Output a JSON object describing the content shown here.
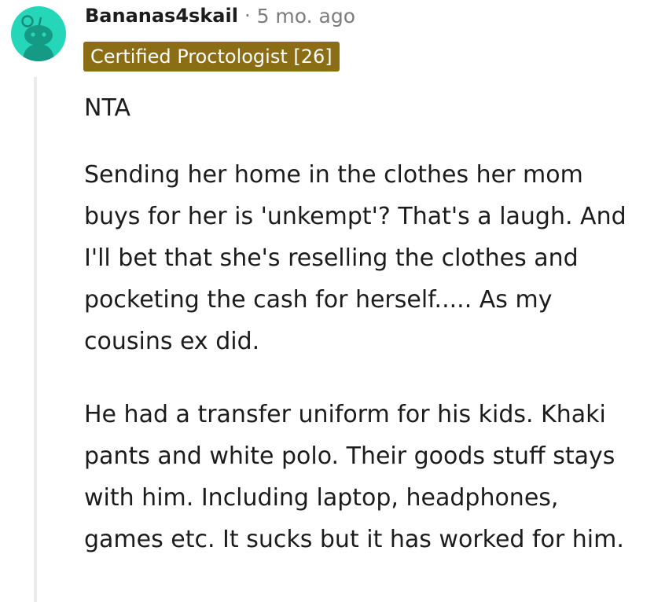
{
  "comment": {
    "author": "Bananas4skail",
    "separator": "·",
    "timestamp": "5 mo. ago",
    "flair": "Certified Proctologist [26]",
    "paragraphs": [
      "NTA",
      "Sending her home in the clothes her mom buys for her is 'unkempt'? That's a laugh. And I'll bet that she's reselling the clothes and pocketing the cash for herself..... As my cousins ex did.",
      "He had a transfer uniform for his kids. Khaki pants and white polo. Their goods stuff stays with him. Including laptop, headphones, games etc. It sucks but it has worked for him."
    ]
  },
  "avatar": {
    "icon": "snoo-avatar-icon",
    "color": "#25d6b8"
  },
  "colors": {
    "flair_bg": "#8a6d14",
    "meta_text": "#7c7c7c",
    "thread_line": "#e9ebed"
  }
}
